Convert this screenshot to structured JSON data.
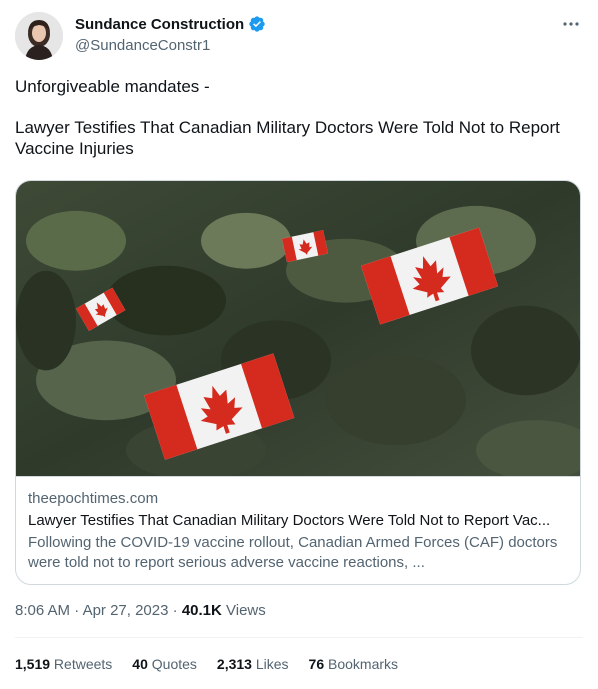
{
  "author": {
    "display_name": "Sundance Construction",
    "handle": "@SundanceConstr1",
    "verified_icon": "verified-badge-icon",
    "verified_color": "#1d9bf0"
  },
  "tweet": {
    "line1": "Unforgiveable mandates -",
    "line2": "Lawyer Testifies That Canadian Military Doctors Were Told Not to Report Vaccine Injuries"
  },
  "card": {
    "domain": "theepochtimes.com",
    "title": "Lawyer Testifies That Canadian Military Doctors Were Told Not to Report Vac...",
    "description": "Following the COVID-19 vaccine rollout, Canadian Armed Forces (CAF) doctors were told not to report serious adverse vaccine reactions, ..."
  },
  "meta": {
    "time": "8:06 AM",
    "sep1": " · ",
    "date": "Apr 27, 2023",
    "sep2": " · ",
    "views": "40.1K",
    "views_label": " Views"
  },
  "stats": {
    "retweets": "1,519",
    "retweets_label": " Retweets",
    "quotes": "40",
    "quotes_label": " Quotes",
    "likes": "2,313",
    "likes_label": " Likes",
    "bookmarks": "76",
    "bookmarks_label": " Bookmarks"
  },
  "colors": {
    "text": "#0f1419",
    "secondary": "#536471",
    "border": "#cfd9de",
    "flag_red": "#d52b1e"
  }
}
